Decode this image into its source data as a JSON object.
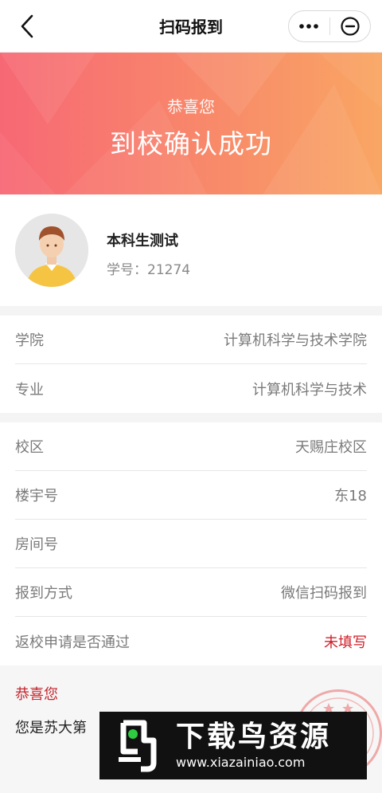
{
  "nav": {
    "title": "扫码报到",
    "back_icon": "chevron-left-icon",
    "more_icon": "more-dots-icon",
    "close_icon": "minus-circle-icon"
  },
  "banner": {
    "subtitle": "恭喜您",
    "title": "到校确认成功",
    "gradient": [
      "#f76875",
      "#f9a663"
    ]
  },
  "profile": {
    "name": "本科生测试",
    "student_id": "学号：21274"
  },
  "section1": {
    "rows": [
      {
        "label": "学院",
        "value": "计算机科学与技术学院"
      },
      {
        "label": "专业",
        "value": "计算机科学与技术"
      }
    ]
  },
  "section2": {
    "rows": [
      {
        "label": "校区",
        "value": "天赐庄校区"
      },
      {
        "label": "楼宇号",
        "value": "东18"
      },
      {
        "label": "房间号",
        "value": ""
      },
      {
        "label": "报到方式",
        "value": "微信扫码报到"
      },
      {
        "label": "返校申请是否通过",
        "value": "未填写"
      }
    ]
  },
  "message": {
    "title": "恭喜您",
    "text": "您是苏大第"
  },
  "watermark": {
    "title": "下载鸟资源",
    "url": "www.xiazainiao.com"
  },
  "colors": {
    "accent_red": "#d01f2a",
    "message_red": "#c4262e"
  }
}
